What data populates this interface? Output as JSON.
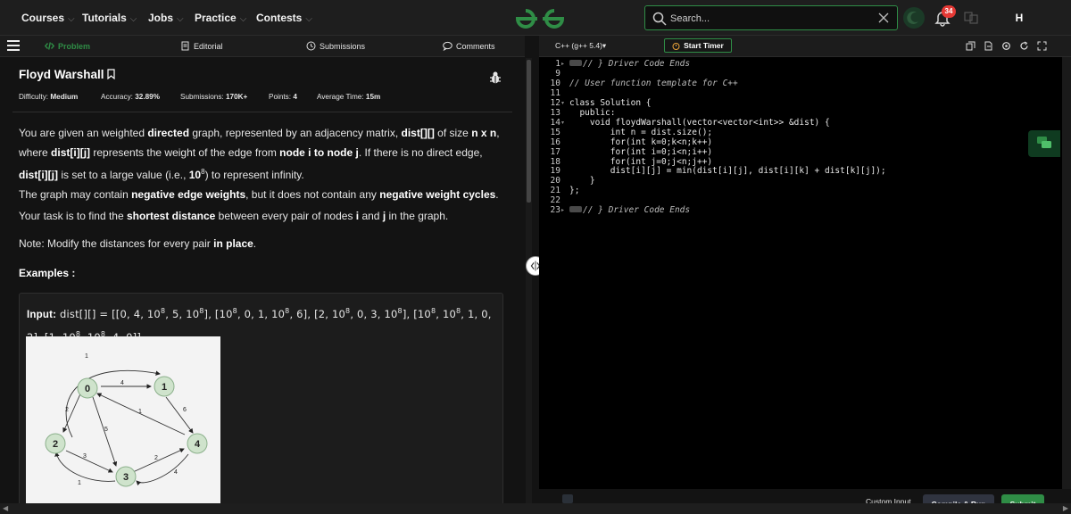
{
  "nav": {
    "items": [
      {
        "label": "Courses"
      },
      {
        "label": "Tutorials"
      },
      {
        "label": "Jobs"
      },
      {
        "label": "Practice"
      },
      {
        "label": "Contests"
      }
    ],
    "search_placeholder": "Search...",
    "notification_count": "34",
    "avatar_initial": "H"
  },
  "tabs": {
    "problem": "Problem",
    "editorial": "Editorial",
    "submissions": "Submissions",
    "comments": "Comments"
  },
  "problem": {
    "title": "Floyd Warshall",
    "difficulty_label": "Difficulty:",
    "difficulty": "Medium",
    "accuracy_label": "Accuracy:",
    "accuracy": "32.89%",
    "submissions_label": "Submissions:",
    "submissions": "170K+",
    "points_label": "Points:",
    "points": "4",
    "avg_time_label": "Average Time:",
    "avg_time": "15m",
    "examples_heading": "Examples :",
    "d1": "You are given an weighted ",
    "d1b": "directed",
    "d2": " graph, represented by an adjacency matrix, ",
    "d2b": "dist[][]",
    "d3": " of size ",
    "d3b": "n x n",
    "d4": ", where ",
    "d4b": "dist[i][j]",
    "d5": " represents the weight of the edge from ",
    "d5b": "node i to node j",
    "d6": ". If there is no direct edge, ",
    "d6b": "dist[i][j]",
    "d7": " is set to a large value (i.e., ",
    "d7b": "10",
    "d7sup": "8",
    "d8": ") to represent infinity.",
    "d9": "The graph may contain ",
    "d9b": "negative edge weights",
    "d10": ", but it does not contain any ",
    "d10b": "negative weight cycles",
    "d11": ".",
    "t1": "Your task is to find the ",
    "t1b": "shortest distance",
    "t2": " between every pair of nodes ",
    "t2b": "i",
    "t3": " and ",
    "t3b": "j",
    "t4": " in the graph.",
    "n1": "Note: Modify the distances for every pair ",
    "n1b": "in place",
    "n2": ".",
    "example_input_label": "Input:",
    "example_input_var": "dist[][] = [[0, 4, 10",
    "e_a": ", 5, 10",
    "e_b": "], [10",
    "e_c": ", 0, 1, 10",
    "e_d": ", 6], [2, 10",
    "e_e": ", 0, 3, 10",
    "e_f": "], [10",
    "e_g": ", 10",
    "e_h": ", 1, 0, 2], [1, 10",
    "e_i": ", 10",
    "e_j": ", 4, 0]]",
    "sup8": "8"
  },
  "graph": {
    "nodes": [
      "0",
      "1",
      "2",
      "3",
      "4"
    ],
    "edge_labels": [
      "1",
      "4",
      "2",
      "5",
      "1",
      "6",
      "3",
      "2",
      "4",
      "1"
    ]
  },
  "editor": {
    "language": "C++ (g++ 5.4)",
    "timer": "Start Timer",
    "lines": [
      {
        "n": "1",
        "fold": "▸",
        "chip": true,
        "text": "// } Driver Code Ends",
        "cls": "cmt"
      },
      {
        "n": "9",
        "fold": "",
        "chip": false,
        "text": "",
        "cls": ""
      },
      {
        "n": "10",
        "fold": "",
        "chip": false,
        "text": "// User function template for C++",
        "cls": "cmt"
      },
      {
        "n": "11",
        "fold": "",
        "chip": false,
        "text": "",
        "cls": ""
      },
      {
        "n": "12",
        "fold": "▾",
        "chip": false,
        "text": "class Solution {",
        "cls": ""
      },
      {
        "n": "13",
        "fold": "",
        "chip": false,
        "text": "  public:",
        "cls": ""
      },
      {
        "n": "14",
        "fold": "▾",
        "chip": false,
        "text": "    void floydWarshall(vector<vector<int>> &dist) {",
        "cls": ""
      },
      {
        "n": "15",
        "fold": "",
        "chip": false,
        "text": "        int n = dist.size();",
        "cls": ""
      },
      {
        "n": "16",
        "fold": "",
        "chip": false,
        "text": "        for(int k=0;k<n;k++)",
        "cls": ""
      },
      {
        "n": "17",
        "fold": "",
        "chip": false,
        "text": "        for(int i=0;i<n;i++)",
        "cls": ""
      },
      {
        "n": "18",
        "fold": "",
        "chip": false,
        "text": "        for(int j=0;j<n;j++)",
        "cls": ""
      },
      {
        "n": "19",
        "fold": "",
        "chip": false,
        "text": "        dist[i][j] = min(dist[i][j], dist[i][k] + dist[k][j]);",
        "cls": ""
      },
      {
        "n": "20",
        "fold": "",
        "chip": false,
        "text": "    }",
        "cls": ""
      },
      {
        "n": "21",
        "fold": "",
        "chip": false,
        "text": "};",
        "cls": ""
      },
      {
        "n": "22",
        "fold": "",
        "chip": false,
        "text": "",
        "cls": ""
      },
      {
        "n": "23",
        "fold": "▸",
        "chip": true,
        "text": "// } Driver Code Ends",
        "cls": "cmt"
      }
    ],
    "custom_input": "Custom Input",
    "compile": "Compile & Run",
    "submit": "Submit"
  },
  "colors": {
    "accent": "#2f8d46",
    "badge": "#e53935"
  }
}
